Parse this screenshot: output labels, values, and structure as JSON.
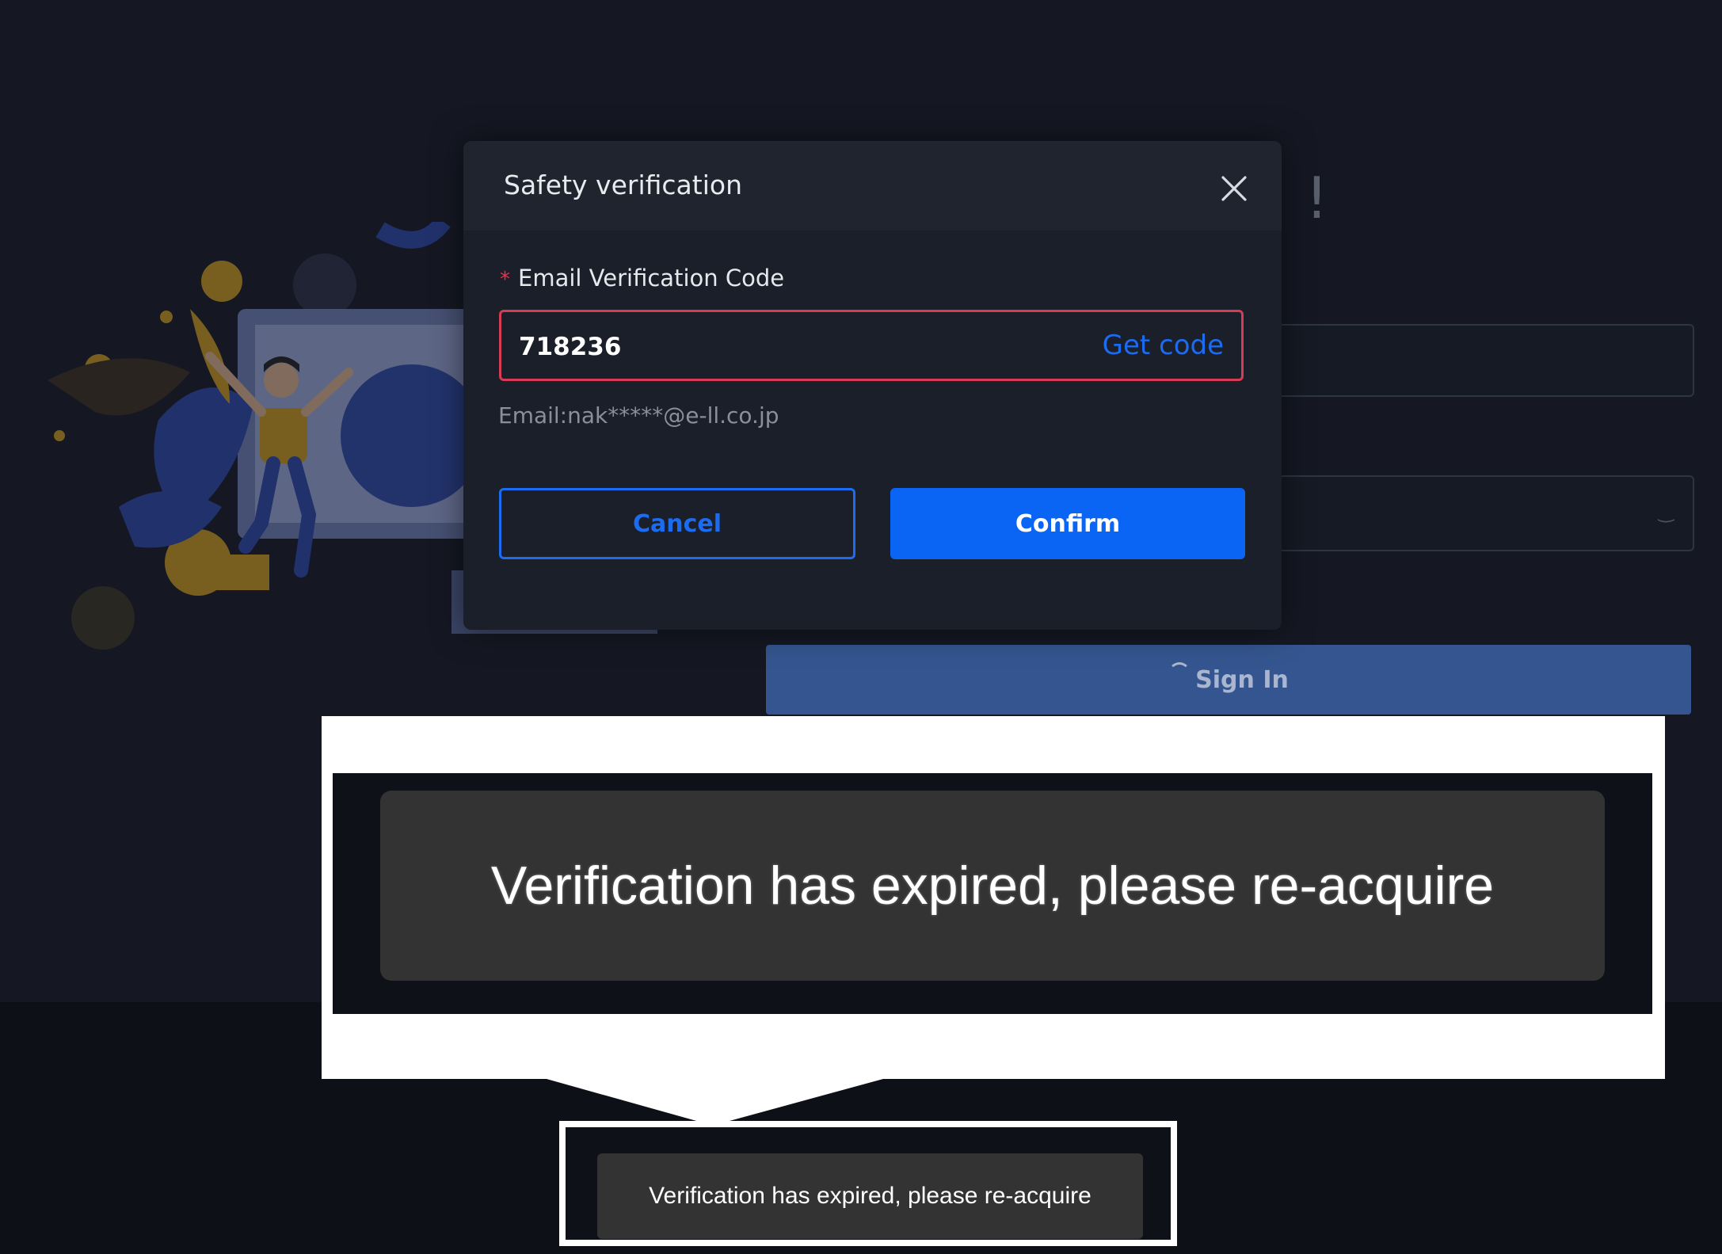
{
  "modal": {
    "title": "Safety verification",
    "field_label": "Email Verification Code",
    "required_marker": "*",
    "code_value": "718236",
    "get_code_label": "Get code",
    "email_hint": "Email:nak*****@e-ll.co.jp",
    "cancel_label": "Cancel",
    "confirm_label": "Confirm"
  },
  "background_form": {
    "heading_fragment": "!",
    "signin_label": "Sign In"
  },
  "toast": {
    "message": "Verification has expired, please re-acquire",
    "zoomed_message": "Verification has expired, please re-acquire"
  },
  "colors": {
    "accent": "#0a65f5",
    "error": "#d63d55",
    "background": "#151823",
    "toast": "#333333"
  },
  "icons": [
    "close-icon",
    "eye-closed-icon",
    "loading-spinner-icon"
  ]
}
